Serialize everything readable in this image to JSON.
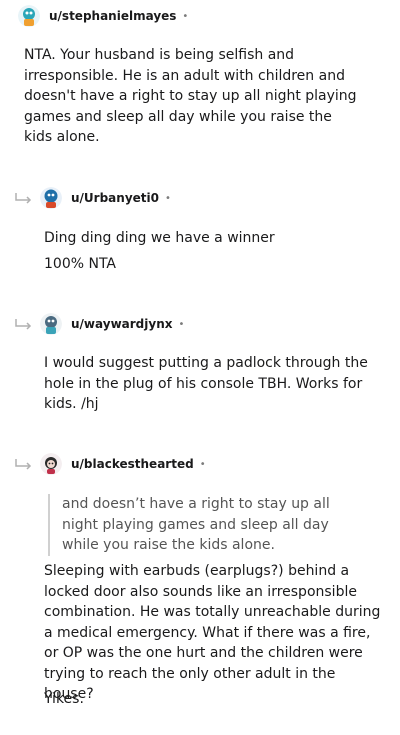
{
  "comments": [
    {
      "username": "u/stephanielmayes",
      "dot": "•",
      "paragraphs": [
        "NTA. Your husband is being selfish and irresponsible. He is an adult with children and doesn't have a right to stay up all night playing games and sleep all day while you raise the kids alone."
      ]
    },
    {
      "username": "u/Urbanyeti0",
      "dot": "•",
      "paragraphs": [
        "Ding ding ding we have a winner",
        "100% NTA"
      ]
    },
    {
      "username": "u/waywardjynx",
      "dot": "•",
      "paragraphs": [
        "I would suggest putting a padlock through the hole in the plug of his console TBH. Works for kids. /hj"
      ]
    },
    {
      "username": "u/blackesthearted",
      "dot": "•",
      "quote": "and doesn’t have a right to stay up all night playing games and sleep all day while you raise the kids alone.",
      "paragraphs": [
        "Sleeping with earbuds (earplugs?) behind a locked door also sounds like an irresponsible combination. He was totally unreachable during a medical emergency. What if there was a fire, or OP was the one hurt and the children were trying to reach the only other adult in the house?",
        "Yikes."
      ]
    }
  ]
}
